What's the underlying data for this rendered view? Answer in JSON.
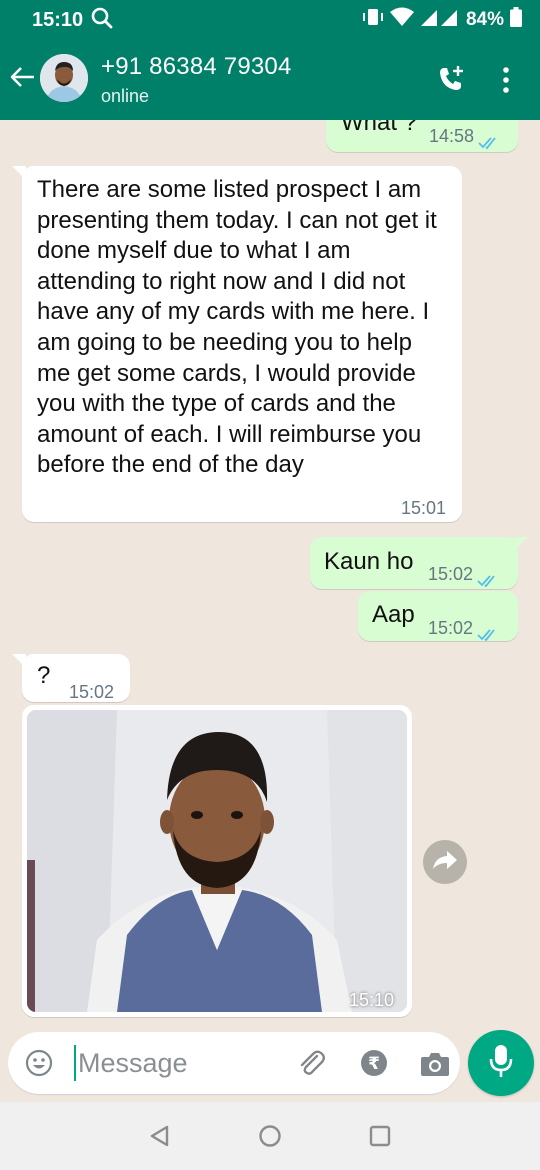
{
  "status_bar": {
    "time": "15:10",
    "battery": "84%"
  },
  "header": {
    "contact_name": "+91 86384 79304",
    "status": "online"
  },
  "messages": [
    {
      "direction": "out",
      "text": "What ?",
      "time": "14:58",
      "read": true
    },
    {
      "direction": "in",
      "text": "There are some listed prospect I am presenting them today. I can not get it done myself due to what I am attending to right now and I did not have any of my cards with me here. I am going to be needing you to help me get some cards, I would provide you with the type of cards and the amount of each. I will reimburse you before the end of the day",
      "time": "15:01"
    },
    {
      "direction": "out",
      "text": "Kaun ho",
      "time": "15:02",
      "read": true
    },
    {
      "direction": "out",
      "text": "Aap",
      "time": "15:02",
      "read": true
    },
    {
      "direction": "in",
      "text": "?",
      "time": "15:02"
    },
    {
      "direction": "in",
      "type": "photo",
      "time": "15:10"
    }
  ],
  "composer": {
    "placeholder": "Message"
  },
  "colors": {
    "header": "#008069",
    "accent": "#00a884",
    "outgoing_bubble": "#d9fdd3",
    "incoming_bubble": "#ffffff",
    "tick_blue": "#53bdeb"
  },
  "icons": [
    "search-icon",
    "vibrate-icon",
    "wifi-icon",
    "signal-icon",
    "battery-icon",
    "back-arrow-icon",
    "add-call-icon",
    "more-vert-icon",
    "double-check-icon",
    "forward-icon",
    "emoji-icon",
    "attach-icon",
    "rupee-icon",
    "camera-icon",
    "mic-icon",
    "nav-back-icon",
    "nav-home-icon",
    "nav-recents-icon"
  ]
}
